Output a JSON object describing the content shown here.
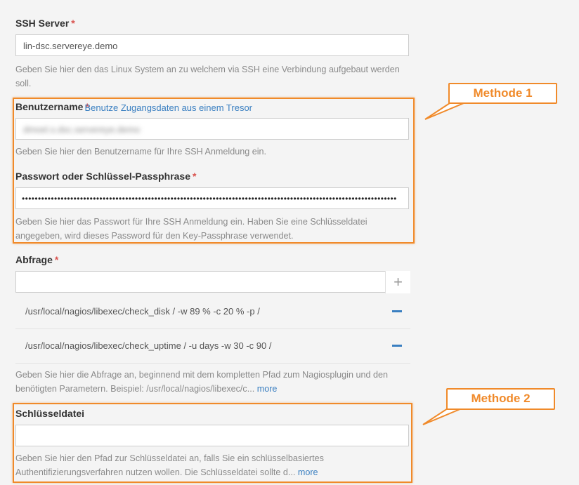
{
  "ssh_server": {
    "label": "SSH Server",
    "required": "*",
    "value": "lin-dsc.servereye.demo",
    "help": "Geben Sie hier den das Linux System an zu welchem via SSH eine Verbindung aufgebaut werden soll."
  },
  "username": {
    "label": "Benutzername",
    "required": "*",
    "vault_link": "Benutze Zugangsdaten aus einem Tresor",
    "value": "dmoel.s.dsc.servereye.demo",
    "help": "Geben Sie hier den Benutzername für Ihre SSH Anmeldung ein."
  },
  "password": {
    "label": "Passwort oder Schlüssel-Passphrase",
    "required": "*",
    "value": "••••••••••••••••••••••••••••••••••••••••••••••••••••••••••••••••••••••••••••••••••••••••••••••••••••••••••••••••••••",
    "help": "Geben Sie hier das Passwort für Ihre SSH Anmeldung ein. Haben Sie eine Schlüsseldatei angegeben, wird dieses Password für den Key-Passphrase verwendet."
  },
  "query": {
    "label": "Abfrage",
    "required": "*",
    "input_value": "",
    "add_icon": "plus-icon",
    "items": [
      "/usr/local/nagios/libexec/check_disk / -w 89 % -c 20 % -p /",
      "/usr/local/nagios/libexec/check_uptime / -u days -w 30 -c 90 /"
    ],
    "help": "Geben Sie hier die Abfrage an, beginnend mit dem kompletten Pfad zum Nagiosplugin und den benötigten Parametern. Beispiel: /usr/local/nagios/libexec/c...",
    "more": "more"
  },
  "keyfile": {
    "label": "Schlüsseldatei",
    "value": "",
    "help": "Geben Sie hier den Pfad zur Schlüsseldatei an, falls Sie ein schlüsselbasiertes Authentifizierungsverfahren nutzen wollen. Die Schlüsseldatei sollte d...",
    "more": "more"
  },
  "annotations": {
    "method1": "Methode 1",
    "method2": "Methode 2",
    "color": "#f08a2a"
  }
}
